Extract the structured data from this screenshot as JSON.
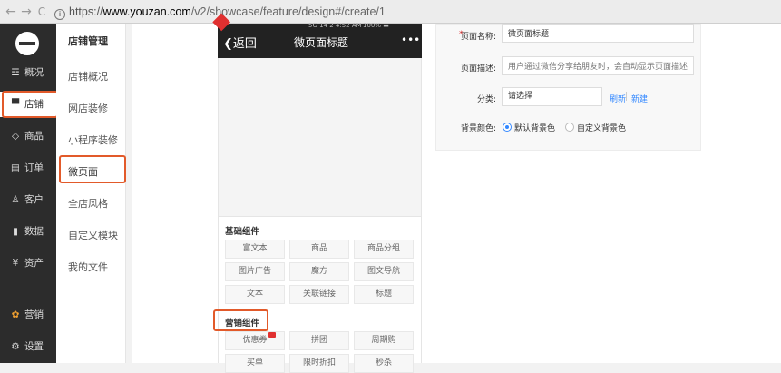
{
  "browser": {
    "back_glyph": "←",
    "forward_glyph": "→",
    "reload_glyph": "C",
    "info_glyph": "i",
    "url_scheme": "https://",
    "url_host": "www.youzan.com",
    "url_path": "/v2/showcase/feature/design#/create/1"
  },
  "sidebar": {
    "items": [
      {
        "icon": "☲",
        "label": "概况"
      },
      {
        "icon": "▀",
        "label": "店铺"
      },
      {
        "icon": "◇",
        "label": "商品"
      },
      {
        "icon": "▤",
        "label": "订单"
      },
      {
        "icon": "♙",
        "label": "客户"
      },
      {
        "icon": "▮",
        "label": "数据"
      },
      {
        "icon": "¥",
        "label": "资产"
      },
      {
        "icon": "✿",
        "label": "营销"
      },
      {
        "icon": "⚙",
        "label": "设置"
      }
    ]
  },
  "submenu": {
    "title": "店铺管理",
    "items": [
      "店铺概况",
      "网店装修",
      "小程序装修",
      "微页面",
      "全店风格",
      "自定义模块",
      "我的文件"
    ]
  },
  "phone": {
    "status_left": "5G 14 2 4:52 AM",
    "status_right": "100% ▬",
    "back_label": "返回",
    "title": "微页面标题",
    "more": "•••"
  },
  "components": {
    "basic_title": "基础组件",
    "basic": [
      "富文本",
      "商品",
      "商品分组",
      "图片广告",
      "魔方",
      "图文导航",
      "文本",
      "关联链接",
      "标题"
    ],
    "marketing_title": "营销组件",
    "marketing": [
      "优惠券",
      "拼团",
      "周期购",
      "买单",
      "限时折扣",
      "秒杀"
    ]
  },
  "form": {
    "required_mark": "*",
    "name_label": "页面名称:",
    "name_value": "微页面标题",
    "desc_label": "页面描述:",
    "desc_placeholder": "用户通过微信分享给朋友时，会自动显示页面描述",
    "category_label": "分类:",
    "category_value": "请选择",
    "refresh_link": "刷新",
    "new_link": "新建",
    "bg_label": "背景颜色:",
    "bg_default": "默认背景色",
    "bg_custom": "自定义背景色"
  },
  "colors": {
    "accent": "#3388ff",
    "highlight": "#e25a2a",
    "sidebar_bg": "#2c2c2c"
  }
}
